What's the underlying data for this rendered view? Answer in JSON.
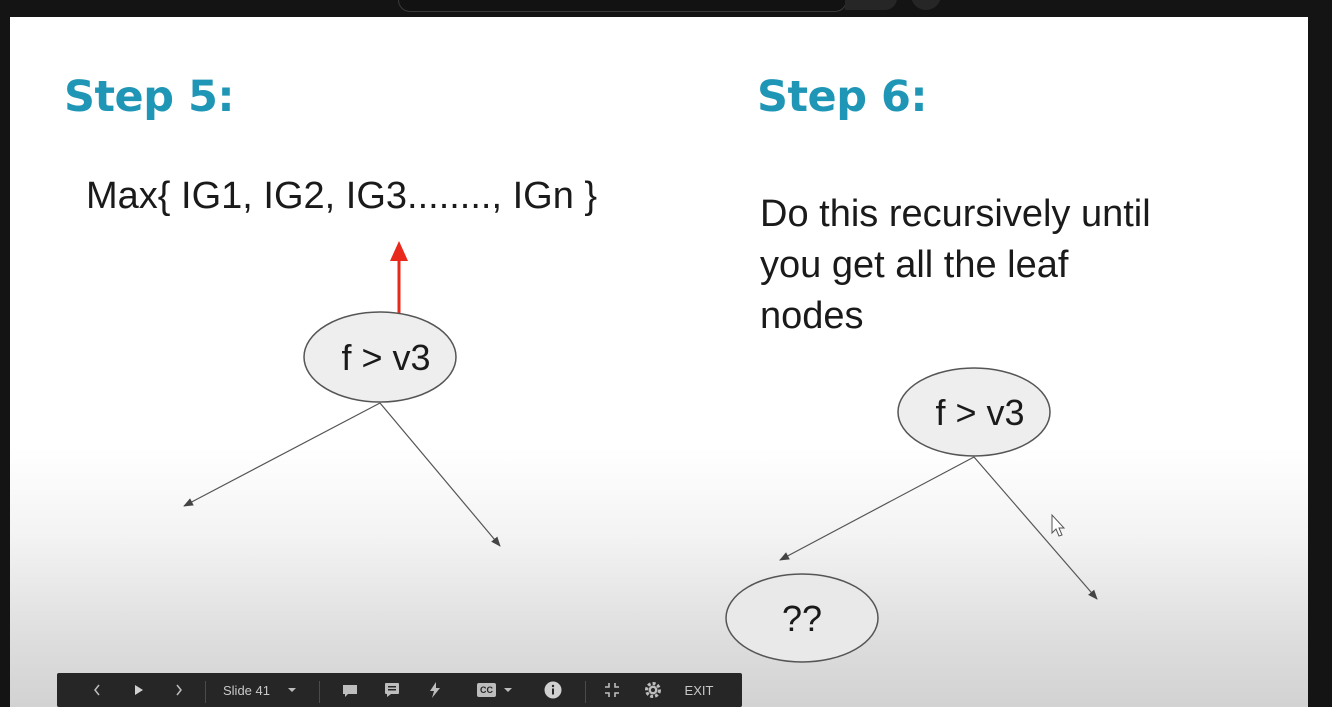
{
  "slide": {
    "step5_title": "Step 5:",
    "step5_formula": "Max{ IG1, IG2, IG3........, IGn }",
    "step5_node": "f > v3",
    "step6_title": "Step 6:",
    "step6_text": "Do this recursively until you get all the leaf nodes",
    "step6_node": "f > v3",
    "step6_leaf": "??"
  },
  "controls": {
    "prev_icon": "chevron-left-icon",
    "play_icon": "play-icon",
    "next_icon": "chevron-right-icon",
    "slide_label": "Slide 41",
    "speaker_notes_icon": "speaker-notes-icon",
    "comments_icon": "comment-icon",
    "laser_icon": "laser-pointer-icon",
    "captions_label": "CC",
    "info_icon": "info-icon",
    "exit_fullscreen_icon": "exit-fullscreen-icon",
    "settings_icon": "gear-icon",
    "exit_label": "EXIT"
  },
  "colors": {
    "heading": "#1f96b5",
    "arrow_highlight": "#e8291c",
    "node_fill": "#eeeeee",
    "toolbar_bg": "#262626"
  }
}
